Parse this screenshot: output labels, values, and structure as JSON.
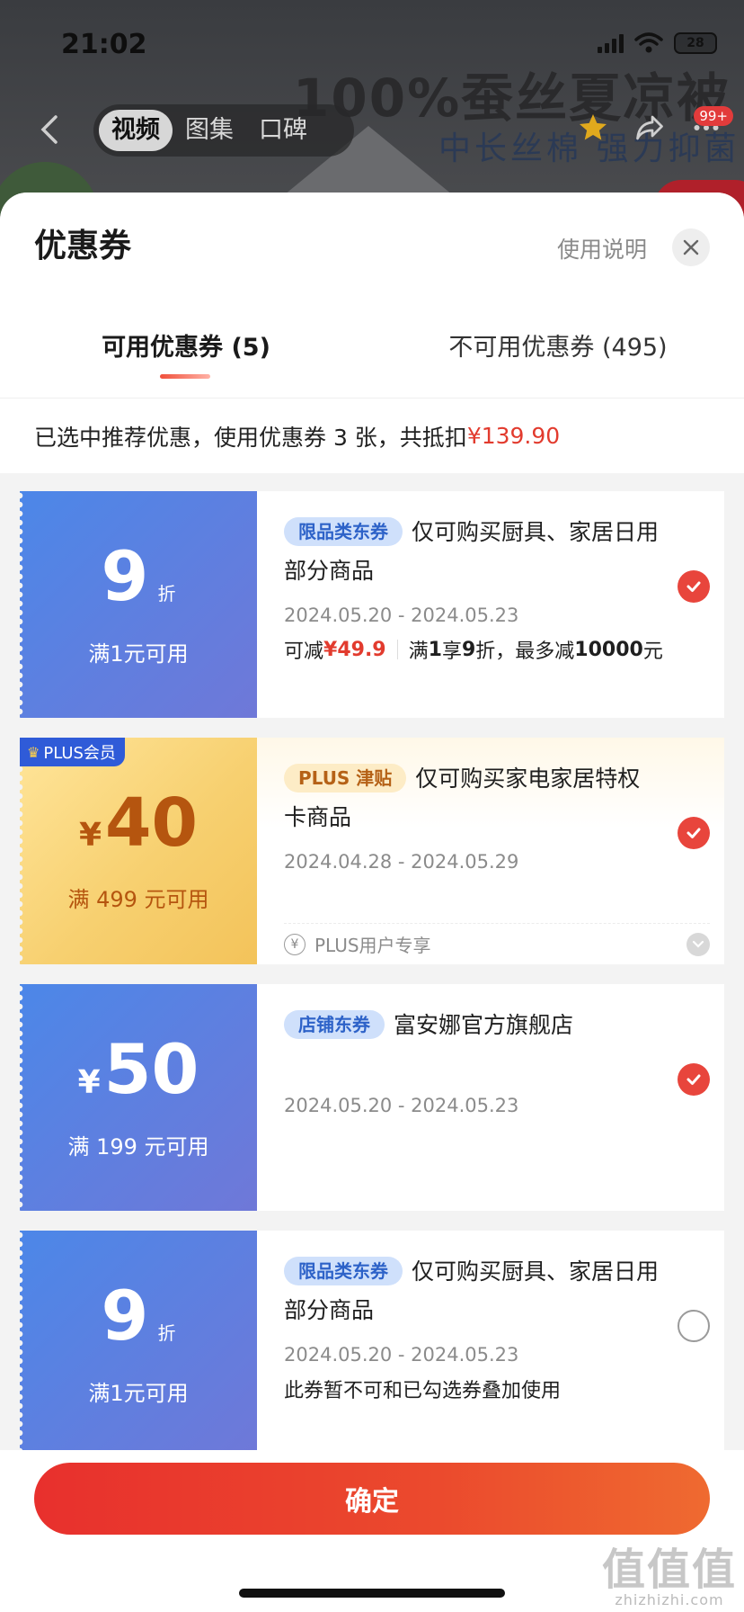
{
  "status_bar": {
    "time": "21:02",
    "battery": "28"
  },
  "product_header": {
    "headline": "100%蚕丝夏凉被",
    "subline": "中长丝棉 强力抑菌",
    "media_tabs": [
      {
        "label": "视频",
        "active": true
      },
      {
        "label": "图集",
        "active": false
      },
      {
        "label": "口碑",
        "active": false
      }
    ],
    "badge": "99+"
  },
  "sheet": {
    "title": "优惠券",
    "help_link": "使用说明",
    "tabs": [
      {
        "label": "可用优惠券 (5)",
        "active": true
      },
      {
        "label": "不可用优惠券 (495)",
        "active": false
      }
    ],
    "summary": {
      "text": "已选中推荐优惠，使用优惠券 3 张，共抵扣",
      "amount": "¥139.90"
    }
  },
  "coupons": [
    {
      "style": "blue",
      "value": "9",
      "unit": "折",
      "condition": "满1元可用",
      "tag": "限品类东券",
      "desc": "仅可购买厨具、家居日用部分商品",
      "date": "2024.05.20 - 2024.05.23",
      "detail_prefix": "可减",
      "detail_amount": "¥49.9",
      "detail_rule_a": "满",
      "detail_rule_b": "1",
      "detail_rule_c": "享",
      "detail_rule_d": "9",
      "detail_rule_e": "折，最多减",
      "detail_rule_f": "10000",
      "detail_rule_g": "元",
      "checked": true
    },
    {
      "style": "gold",
      "badge": "PLUS会员",
      "yen": "¥",
      "value": "40",
      "condition": "满 499 元可用",
      "tag": "PLUS 津贴",
      "desc": "仅可购买家电家居特权卡商品",
      "date": "2024.04.28 - 2024.05.29",
      "note": "PLUS用户专享",
      "checked": true
    },
    {
      "style": "blue",
      "yen": "¥",
      "value": "50",
      "condition": "满 199 元可用",
      "tag": "店铺东券",
      "desc": "富安娜官方旗舰店",
      "date": "2024.05.20 - 2024.05.23",
      "checked": true
    },
    {
      "style": "blue",
      "value": "9",
      "unit": "折",
      "condition": "满1元可用",
      "tag": "限品类东券",
      "desc": "仅可购买厨具、家居日用部分商品",
      "date": "2024.05.20 - 2024.05.23",
      "note": "此券暂不可和已勾选券叠加使用",
      "checked": false
    }
  ],
  "footer": {
    "confirm_label": "确定",
    "watermark_big": "值值值",
    "watermark_small": "zhizhizhi.com"
  },
  "colors": {
    "accent": "#e8302d",
    "coupon_blue": "#4c87e8",
    "coupon_gold": "#f7d070"
  }
}
